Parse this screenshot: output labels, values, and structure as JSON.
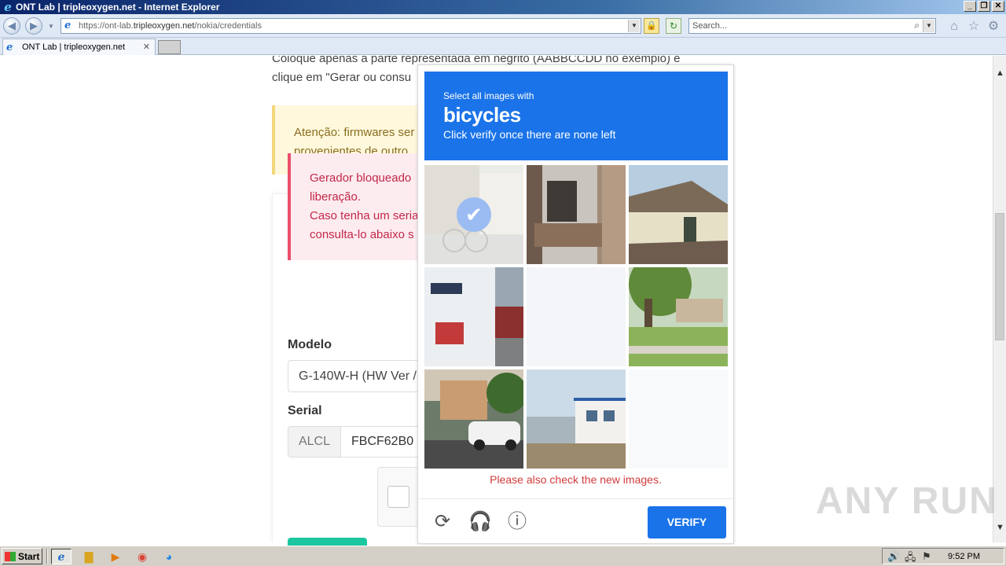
{
  "window": {
    "title": "ONT Lab | tripleoxygen.net - Internet Explorer",
    "controls": {
      "minimize": "_",
      "restore": "❐",
      "close": "✕"
    }
  },
  "addressbar": {
    "url_prefix": "https://ont-lab.",
    "url_domain": "tripleoxygen.net",
    "url_path": "/nokia/credentials",
    "search_placeholder": "Search..."
  },
  "tabs": [
    {
      "label": "ONT Lab | tripleoxygen.net",
      "active": true
    }
  ],
  "page": {
    "intro_line1": "Coloque apenas a parte representada em negrito (AABBCCDD no exemplo) e",
    "intro_line2": "clique em \"Gerar ou consu",
    "warning_line1": "Atenção: firmwares ser",
    "warning_line2": "provenientes de outro",
    "error_line1": "Gerador bloqueado",
    "error_line2": "liberação.",
    "error_line3": "Caso tenha um seria",
    "error_line4": "consulta-lo abaixo s",
    "model_label": "Modelo",
    "model_value": "G-140W-H (HW Ver /",
    "serial_label": "Serial",
    "serial_prefix": "ALCL",
    "serial_value": "FBCF62B0"
  },
  "captcha": {
    "prompt_small": "Select all images with",
    "prompt_big": "bicycles",
    "prompt_hint": "Click verify once there are none left",
    "tiles": [
      {
        "content": "bicycles street",
        "selected": true,
        "loading": false
      },
      {
        "content": "balcony building",
        "selected": false,
        "loading": false
      },
      {
        "content": "house roof",
        "selected": false,
        "loading": false
      },
      {
        "content": "bus",
        "selected": false,
        "loading": false
      },
      {
        "content": "",
        "selected": false,
        "loading": true
      },
      {
        "content": "tree yard",
        "selected": false,
        "loading": false
      },
      {
        "content": "car street",
        "selected": false,
        "loading": false
      },
      {
        "content": "building",
        "selected": false,
        "loading": false
      },
      {
        "content": "",
        "selected": false,
        "loading": true
      }
    ],
    "new_images_msg": "Please also check the new images.",
    "verify_label": "VERIFY",
    "icons": [
      "refresh-icon",
      "headphones-icon",
      "info-icon"
    ]
  },
  "watermark": "ANY RUN",
  "taskbar": {
    "start_label": "Start",
    "clock": "9:52 PM"
  },
  "colors": {
    "captcha_blue": "#1a73e8",
    "error_red": "#d33b3b",
    "warning_bg": "#fff8dc",
    "error_bg": "#fdecef"
  }
}
